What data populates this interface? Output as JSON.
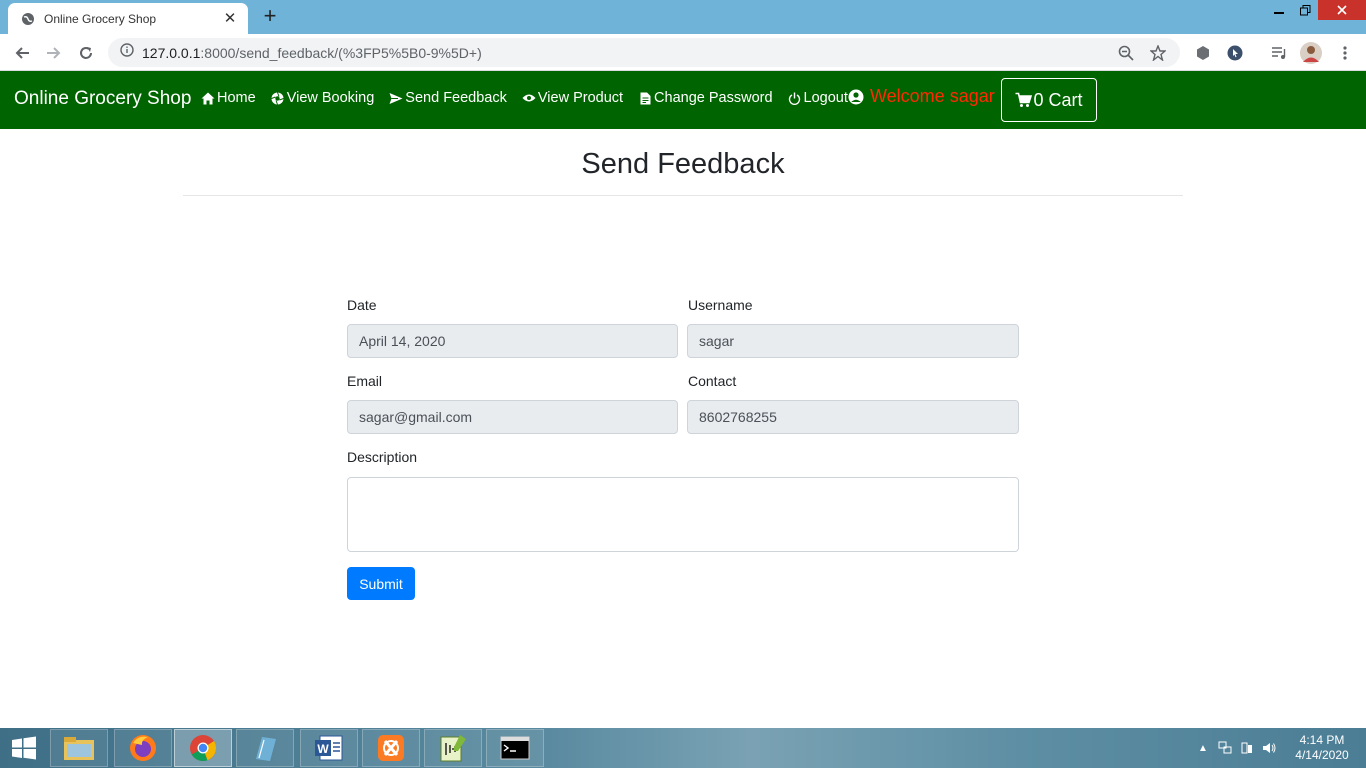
{
  "browser": {
    "tab_title": "Online Grocery Shop",
    "new_tab_label": "+",
    "url_host": "127.0.0.1",
    "url_path": ":8000/send_feedback/(%3FP5%5B0-9%5D+)"
  },
  "navbar": {
    "brand": "Online Grocery Shop",
    "links": [
      {
        "label": "Home",
        "icon": "home-icon"
      },
      {
        "label": "View Booking",
        "icon": "aperture-icon"
      },
      {
        "label": "Send Feedback",
        "icon": "paper-plane-icon"
      },
      {
        "label": "View Product",
        "icon": "eye-icon"
      },
      {
        "label": "Change Password",
        "icon": "file-icon"
      },
      {
        "label": "Logout",
        "icon": "power-icon"
      }
    ],
    "welcome": "Welcome sagar",
    "cart_label": "0 Cart",
    "welcome_color": "#ff2a00",
    "bar_color": "#006400"
  },
  "page": {
    "title": "Send Feedback"
  },
  "form": {
    "date_label": "Date",
    "date_value": "April 14, 2020",
    "username_label": "Username",
    "username_value": "sagar",
    "email_label": "Email",
    "email_value": "sagar@gmail.com",
    "contact_label": "Contact",
    "contact_value": "8602768255",
    "description_label": "Description",
    "description_value": "",
    "submit_label": "Submit",
    "submit_color": "#007bff"
  },
  "taskbar": {
    "time": "4:14 PM",
    "date": "4/14/2020"
  }
}
